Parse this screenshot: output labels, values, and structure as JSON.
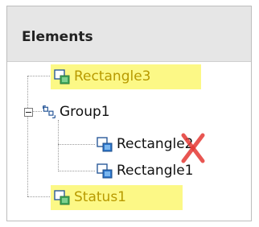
{
  "panel": {
    "title": "Elements"
  },
  "tree": {
    "nodes": [
      {
        "label": "Rectangle3",
        "icon": "rectangle-shape-icon",
        "highlighted": true
      },
      {
        "label": "Group1",
        "icon": "group-icon",
        "expanded": true,
        "expander": "collapse-minus-icon"
      },
      {
        "label": "Rectangle2",
        "icon": "rectangle-shape-icon",
        "marked_deleted": true,
        "mark": "red-x-icon"
      },
      {
        "label": "Rectangle1",
        "icon": "rectangle-shape-icon"
      },
      {
        "label": "Status1",
        "icon": "status-shape-icon",
        "highlighted": true
      }
    ]
  },
  "colors": {
    "highlight": "#fcf886",
    "highlight_text": "#b89a00",
    "normal_text": "#111111",
    "header_bg": "#e6e6e6",
    "delete_mark": "#e53935"
  }
}
